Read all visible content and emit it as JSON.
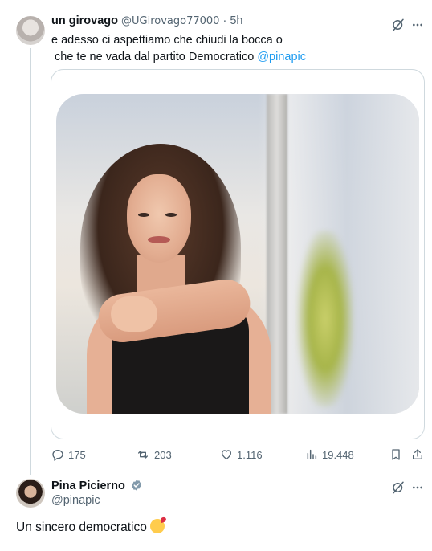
{
  "tweet1": {
    "author_name": "un girovago",
    "handle": "@UGirovago77000",
    "separator": "·",
    "time": "5h",
    "text_line1": "e adesso ci aspettiamo che chiudi la bocca o",
    "text_line2": " che te ne vada dal partito Democratico ",
    "mention": "@pinapic",
    "actions": {
      "replies": "175",
      "reposts": "203",
      "likes": "1.116",
      "views": "19.448"
    },
    "icons": [
      "grok-icon",
      "more-icon",
      "reply-icon",
      "repost-icon",
      "like-icon",
      "views-icon",
      "bookmark-icon",
      "share-icon"
    ]
  },
  "tweet2": {
    "author_name": "Pina Picierno",
    "handle": "@pinapic",
    "text": "Un sincero democratico",
    "emoji": "face-blowing-kiss",
    "icons": [
      "verified-badge-icon",
      "grok-icon",
      "more-icon"
    ]
  },
  "colors": {
    "accent": "#1d9bf0",
    "muted_text": "#536471",
    "border": "#cfd9de",
    "verified_badge": "#829aab"
  }
}
